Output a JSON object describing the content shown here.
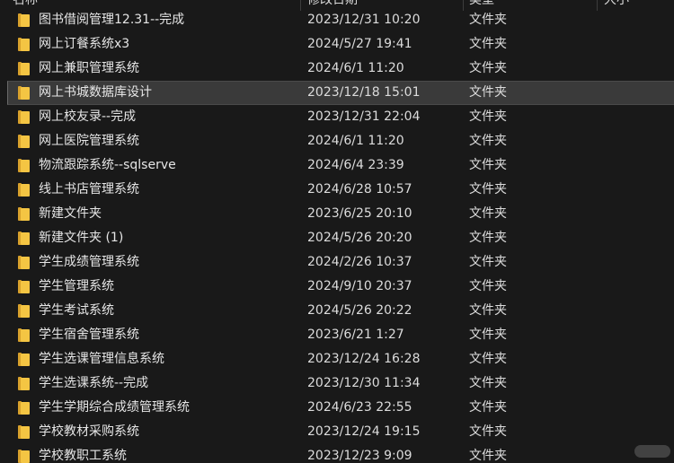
{
  "header": {
    "name": "名称",
    "date_modified": "修改日期",
    "type": "类型",
    "size": "大小"
  },
  "files": [
    {
      "name": "图书借阅管理12.31--完成",
      "date": "2023/12/31 10:20",
      "type": "文件夹",
      "icon": "folder-icon"
    },
    {
      "name": "网上订餐系统x3",
      "date": "2024/5/27 19:41",
      "type": "文件夹",
      "icon": "folder-icon"
    },
    {
      "name": "网上兼职管理系统",
      "date": "2024/6/1 11:20",
      "type": "文件夹",
      "icon": "folder-icon"
    },
    {
      "name": "网上书城数据库设计",
      "date": "2023/12/18 15:01",
      "type": "文件夹",
      "icon": "folder-icon",
      "selected": true
    },
    {
      "name": "网上校友录--完成",
      "date": "2023/12/31 22:04",
      "type": "文件夹",
      "icon": "folder-icon"
    },
    {
      "name": "网上医院管理系统",
      "date": "2024/6/1 11:20",
      "type": "文件夹",
      "icon": "folder-icon"
    },
    {
      "name": "物流跟踪系统--sqlserve",
      "date": "2024/6/4 23:39",
      "type": "文件夹",
      "icon": "folder-icon"
    },
    {
      "name": "线上书店管理系统",
      "date": "2024/6/28 10:57",
      "type": "文件夹",
      "icon": "folder-icon"
    },
    {
      "name": "新建文件夹",
      "date": "2023/6/25 20:10",
      "type": "文件夹",
      "icon": "folder-icon"
    },
    {
      "name": "新建文件夹 (1)",
      "date": "2024/5/26 20:20",
      "type": "文件夹",
      "icon": "folder-icon"
    },
    {
      "name": "学生成绩管理系统",
      "date": "2024/2/26 10:37",
      "type": "文件夹",
      "icon": "folder-icon"
    },
    {
      "name": "学生管理系统",
      "date": "2024/9/10 20:37",
      "type": "文件夹",
      "icon": "folder-icon"
    },
    {
      "name": "学生考试系统",
      "date": "2024/5/26 20:22",
      "type": "文件夹",
      "icon": "folder-icon"
    },
    {
      "name": "学生宿舍管理系统",
      "date": "2023/6/21 1:27",
      "type": "文件夹",
      "icon": "folder-icon"
    },
    {
      "name": "学生选课管理信息系统",
      "date": "2023/12/24 16:28",
      "type": "文件夹",
      "icon": "folder-icon"
    },
    {
      "name": "学生选课系统--完成",
      "date": "2023/12/30 11:34",
      "type": "文件夹",
      "icon": "folder-icon"
    },
    {
      "name": "学生学期综合成绩管理系统",
      "date": "2024/6/23 22:55",
      "type": "文件夹",
      "icon": "folder-icon"
    },
    {
      "name": "学校教材采购系统",
      "date": "2023/12/24 19:15",
      "type": "文件夹",
      "icon": "folder-icon"
    },
    {
      "name": "学校教职工系统",
      "date": "2023/12/23 9:09",
      "type": "文件夹",
      "icon": "folder-icon"
    }
  ],
  "colors": {
    "background": "#191919",
    "selection": "#3a3a3a",
    "folder": "#f4c543"
  }
}
